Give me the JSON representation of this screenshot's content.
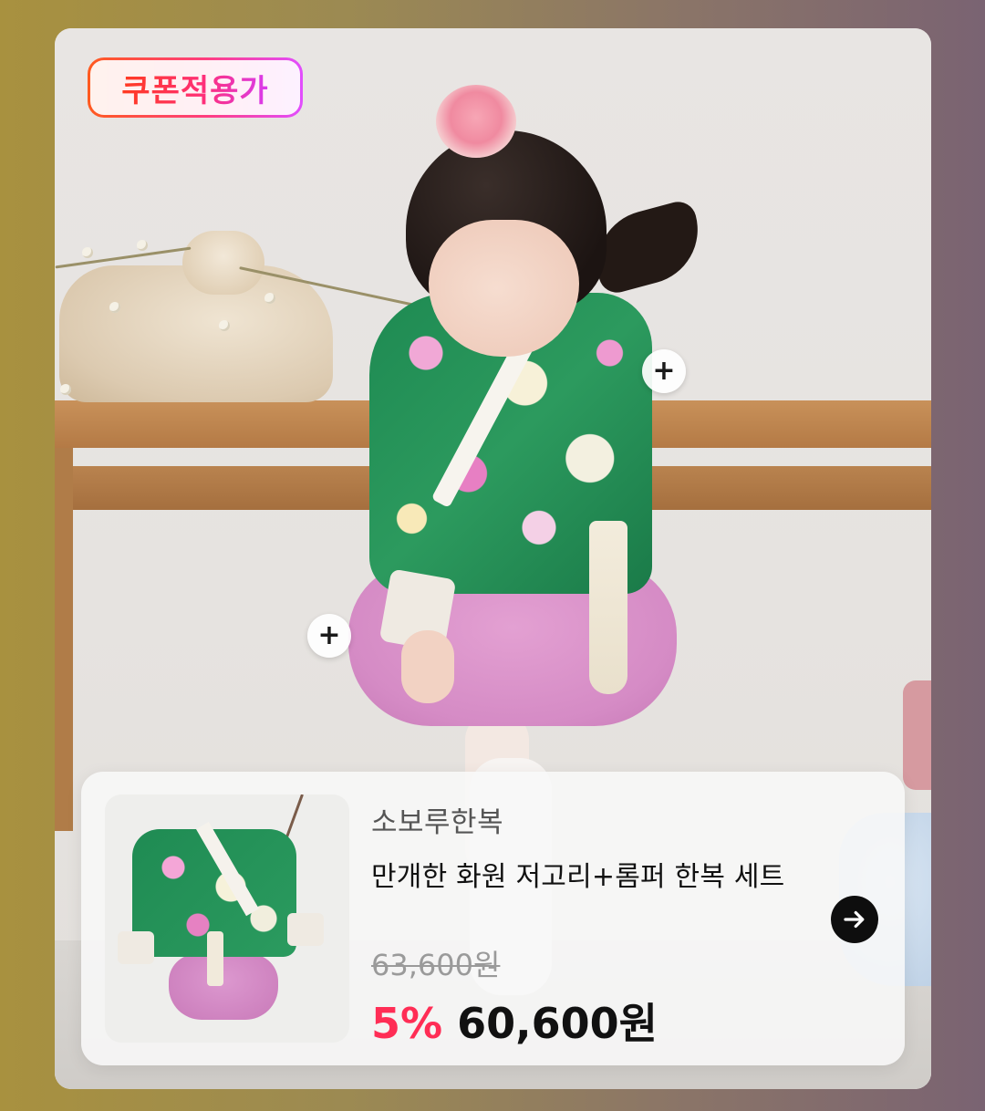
{
  "coupon_badge": {
    "label": "쿠폰적용가"
  },
  "hotspots": [
    {
      "symbol": "+"
    },
    {
      "symbol": "+"
    }
  ],
  "product": {
    "brand": "소보루한복",
    "name": "만개한 화원 저고리+롬퍼 한복 세트",
    "original_price": "63,600원",
    "discount": "5%",
    "sale_price": "60,600원",
    "arrow_icon": "arrow-right-icon"
  },
  "colors": {
    "discount": "#ff2d55",
    "badge_gradient_start": "#ff5a1f",
    "badge_gradient_end": "#e14dff",
    "arrow_button": "#0e0e0e"
  }
}
